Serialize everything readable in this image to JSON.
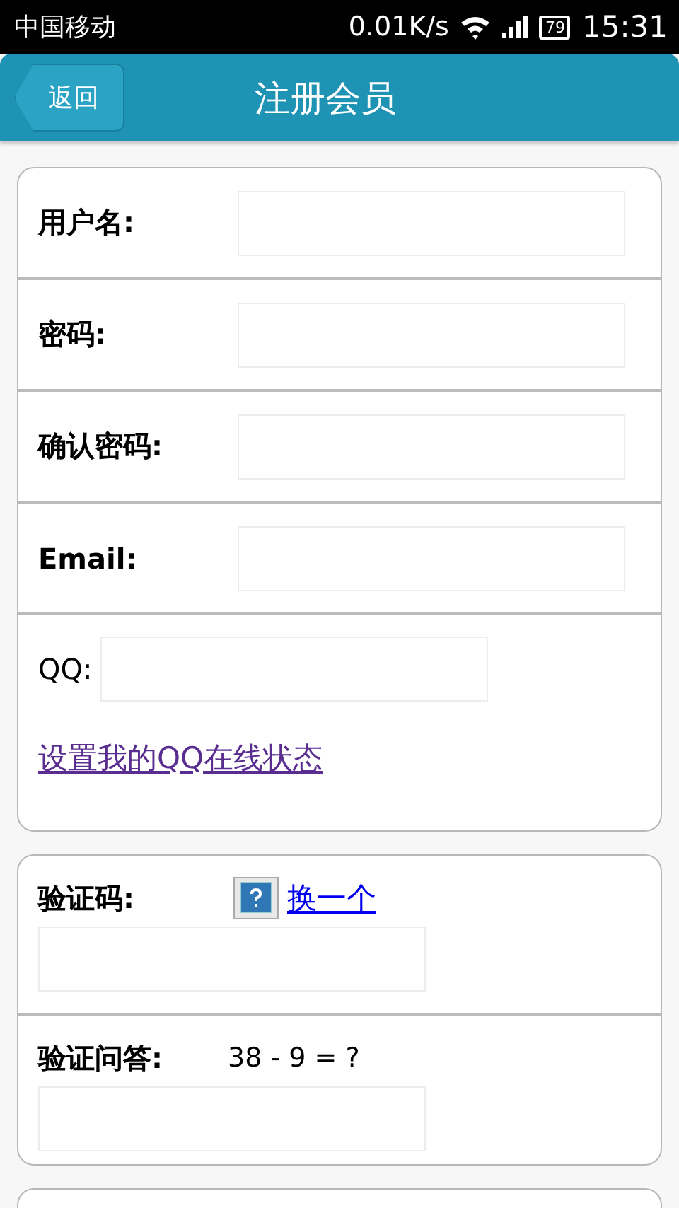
{
  "status_bar": {
    "carrier": "中国移动",
    "speed": "0.01K/s",
    "battery": "79",
    "time": "15:31"
  },
  "header": {
    "back": "返回",
    "title": "注册会员"
  },
  "account_fields": [
    {
      "label": "用户名:"
    },
    {
      "label": "密码:"
    },
    {
      "label": "确认密码:"
    },
    {
      "label": "Email:"
    }
  ],
  "qq": {
    "label": "QQ:",
    "link": {
      "text": "设置我的QQ在线状态",
      "visited": true
    }
  },
  "verification": {
    "captcha": {
      "label": "验证码:",
      "link": {
        "text": "换一个",
        "visited": false
      }
    },
    "question": {
      "label": "验证问答:",
      "text": "38 - 9 = ?"
    }
  }
}
